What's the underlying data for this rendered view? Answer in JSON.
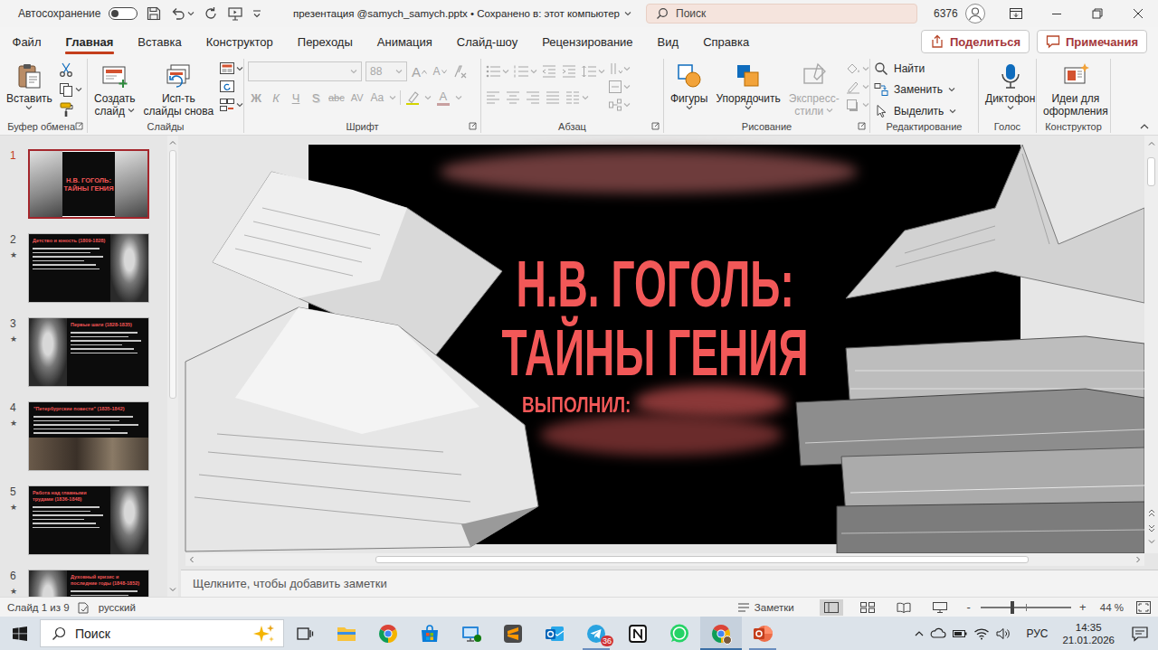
{
  "titlebar": {
    "autosave_label": "Автосохранение",
    "autosave_on": false,
    "document_title": "презентация @samych_samych.pptx • Сохранено в: этот компьютер",
    "search_placeholder": "Поиск",
    "account": "6376"
  },
  "menu_tabs": [
    {
      "label": "Файл",
      "selected": false
    },
    {
      "label": "Главная",
      "selected": true
    },
    {
      "label": "Вставка",
      "selected": false
    },
    {
      "label": "Конструктор",
      "selected": false
    },
    {
      "label": "Переходы",
      "selected": false
    },
    {
      "label": "Анимация",
      "selected": false
    },
    {
      "label": "Слайд-шоу",
      "selected": false
    },
    {
      "label": "Рецензирование",
      "selected": false
    },
    {
      "label": "Вид",
      "selected": false
    },
    {
      "label": "Справка",
      "selected": false
    }
  ],
  "share_label": "Поделиться",
  "comments_label": "Примечания",
  "ribbon": {
    "clipboard": {
      "label": "Буфер обмена",
      "paste": "Вставить"
    },
    "slides": {
      "label": "Слайды",
      "new_slide": [
        "Создать",
        "слайд"
      ],
      "reuse_slides": [
        "Исп-ть",
        "слайды снова"
      ]
    },
    "font": {
      "label": "Шрифт",
      "disabled": true,
      "font_size": "88",
      "grow": "A",
      "shrink": "A",
      "styles": [
        {
          "label": "Ж",
          "kind": "bold"
        },
        {
          "label": "К",
          "kind": "italic"
        },
        {
          "label": "Ч",
          "kind": "underline"
        },
        {
          "label": "S",
          "kind": "shadow"
        },
        {
          "label": "abc",
          "kind": "strike"
        },
        {
          "label": "AV",
          "kind": "spacing"
        },
        {
          "label": "Aa",
          "kind": "case"
        }
      ],
      "font_color": "A"
    },
    "paragraph": {
      "label": "Абзац",
      "disabled": true
    },
    "drawing": {
      "label": "Рисование",
      "shapes": "Фигуры",
      "arrange": "Упорядочить",
      "quick_styles": [
        "Экспресс-",
        "стили"
      ],
      "quick_styles_disabled": true
    },
    "editing": {
      "label": "Редактирование",
      "items": [
        {
          "label": "Найти",
          "kind": "find",
          "dropdown": false
        },
        {
          "label": "Заменить",
          "kind": "replace",
          "dropdown": true
        },
        {
          "label": "Выделить",
          "kind": "select",
          "dropdown": true
        }
      ]
    },
    "voice": {
      "label": "Голос",
      "dictate": "Диктофон"
    },
    "designer": {
      "label": "Конструктор",
      "ideas": [
        "Идеи для",
        "оформления"
      ]
    }
  },
  "animation_mark": "★",
  "thumbnails": [
    {
      "number": "1",
      "selected": true,
      "animated": false,
      "kind": "cover",
      "title": "Н.В. ГОГОЛЬ: ТАЙНЫ ГЕНИЯ"
    },
    {
      "number": "2",
      "selected": false,
      "animated": true,
      "kind": "text-left",
      "title": "Детство и юность (1809-1828)"
    },
    {
      "number": "3",
      "selected": false,
      "animated": true,
      "kind": "text-right",
      "title": "Первые шаги (1828-1835)"
    },
    {
      "number": "4",
      "selected": false,
      "animated": true,
      "kind": "full",
      "title": "\"Петербургские повести\" (1835-1842)"
    },
    {
      "number": "5",
      "selected": false,
      "animated": true,
      "kind": "text-left",
      "title": "Работа над главными трудами (1836-1848)"
    },
    {
      "number": "6",
      "selected": false,
      "animated": true,
      "kind": "text-right",
      "title": "Духовный кризис и последние годы (1848-1852)"
    }
  ],
  "slide": {
    "title_lines": [
      "Н.В. ГОГОЛЬ:",
      "ТАЙНЫ ГЕНИЯ"
    ],
    "author_label": "ВЫПОЛНИЛ:"
  },
  "notes_placeholder": "Щелкните, чтобы добавить заметки",
  "status_bar": {
    "slide_info": "Слайд 1 из 9",
    "language": "русский",
    "notes_label": "Заметки",
    "views": [
      {
        "kind": "normal",
        "selected": true
      },
      {
        "kind": "sorter",
        "selected": false
      },
      {
        "kind": "reading",
        "selected": false
      },
      {
        "kind": "slideshow",
        "selected": false
      }
    ],
    "zoom_out": "-",
    "zoom_in": "+",
    "zoom_level": 0.35,
    "zoom": "44 %"
  },
  "taskbar": {
    "search_placeholder": "Поиск",
    "apps": [
      {
        "kind": "task-view",
        "running": false,
        "active": false
      },
      {
        "kind": "explorer",
        "running": false,
        "active": false
      },
      {
        "kind": "chrome",
        "running": false,
        "active": false
      },
      {
        "kind": "store",
        "running": false,
        "active": false
      },
      {
        "kind": "remote",
        "running": false,
        "active": false
      },
      {
        "kind": "sublime",
        "running": false,
        "active": false
      },
      {
        "kind": "outlook",
        "running": false,
        "active": false
      },
      {
        "kind": "telegram",
        "running": true,
        "active": false,
        "badge": "36"
      },
      {
        "kind": "notes",
        "running": false,
        "active": false
      },
      {
        "kind": "whatsapp",
        "running": false,
        "active": false
      },
      {
        "kind": "chrome-profile",
        "running": true,
        "active": true
      },
      {
        "kind": "powerpoint",
        "running": true,
        "active": false
      }
    ],
    "language": "РУС",
    "time": "14:35",
    "date": "21.01.2026"
  }
}
